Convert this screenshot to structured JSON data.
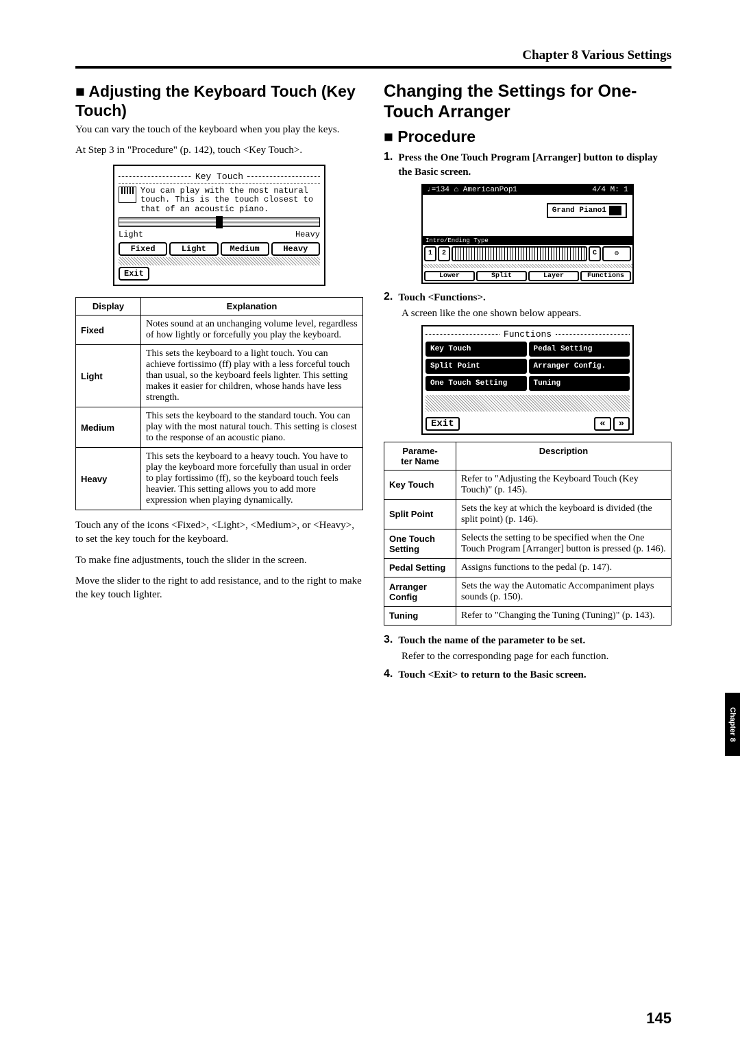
{
  "chapter_header": "Chapter 8 Various Settings",
  "left": {
    "heading": "■ Adjusting the Keyboard Touch (Key Touch)",
    "intro": "You can vary the touch of the keyboard when you play the keys.",
    "step_ref": "At Step 3 in \"Procedure\" (p. 142), touch <Key Touch>.",
    "lcd": {
      "title": "Key Touch",
      "desc": "You can play with the most natural touch. This is the touch closest to that of an acoustic piano.",
      "slider_left": "Light",
      "slider_right": "Heavy",
      "buttons": [
        "Fixed",
        "Light",
        "Medium",
        "Heavy"
      ],
      "exit": "Exit"
    },
    "table_headers": {
      "display": "Display",
      "explanation": "Explanation"
    },
    "table": [
      {
        "label": "Fixed",
        "text": "Notes sound at an unchanging volume level, regardless of how lightly or forcefully you play the keyboard."
      },
      {
        "label": "Light",
        "text": "This sets the keyboard to a light touch. You can achieve fortissimo (ff) play with a less forceful touch than usual, so the keyboard feels lighter. This setting makes it easier for children, whose hands have less strength."
      },
      {
        "label": "Medium",
        "text": "This sets the keyboard to the standard touch. You can play with the most natural touch. This setting is closest to the response of an acoustic piano."
      },
      {
        "label": "Heavy",
        "text": "This sets the keyboard to a heavy touch. You have to play the keyboard more forcefully than usual in order to play fortissimo (ff), so the keyboard touch feels heavier. This setting allows you to add more expression when playing dynamically."
      }
    ],
    "after1": "Touch any of the icons <Fixed>, <Light>, <Medium>, or <Heavy>, to set the key touch for the keyboard.",
    "after2": "To make fine adjustments, touch the slider in the screen.",
    "after3": "Move the slider to the right to add resistance, and to the right to make the key touch lighter."
  },
  "right": {
    "heading_big": "Changing the Settings for One-Touch Arranger",
    "heading_sub": "■ Procedure",
    "steps": {
      "s1": {
        "num": "1.",
        "text": "Press the One Touch Program [Arranger] button to display the Basic screen."
      },
      "s2": {
        "num": "2.",
        "text": "Touch <Functions>.",
        "sub": "A screen like the one shown below appears."
      },
      "s3": {
        "num": "3.",
        "text": "Touch the name of the parameter to be set.",
        "sub": "Refer to the corresponding page for each function."
      },
      "s4": {
        "num": "4.",
        "text": "Touch <Exit> to return to the Basic screen."
      }
    },
    "lcd_basic": {
      "top_left": "♩=134 ⌂ AmericanPop1",
      "top_right": "4/4 M:  1",
      "tone": "Grand Piano1",
      "strip": "Intro/Ending Type",
      "row1": [
        "1",
        "2"
      ],
      "row1_suffix": "C",
      "row2": [
        "Lower",
        "Split",
        "Layer",
        "Functions"
      ]
    },
    "lcd_functions": {
      "title": "Functions",
      "cells": [
        "Key Touch",
        "Pedal Setting",
        "Split Point",
        "Arranger Config.",
        "One Touch Setting",
        "Tuning"
      ],
      "exit": "Exit",
      "arrows": [
        "«",
        "»"
      ]
    },
    "table_headers": {
      "param": "Parame-\nter Name",
      "desc": "Description"
    },
    "table": [
      {
        "label": "Key Touch",
        "text": "Refer to \"Adjusting the Keyboard Touch (Key Touch)\" (p. 145)."
      },
      {
        "label": "Split Point",
        "text": "Sets the key at which the keyboard is divided (the split point) (p. 146)."
      },
      {
        "label": "One Touch Setting",
        "text": "Selects the setting to be specified when the One Touch Program [Arranger] button is pressed (p. 146)."
      },
      {
        "label": "Pedal Setting",
        "text": "Assigns functions to the pedal (p. 147)."
      },
      {
        "label": "Arranger Config",
        "text": "Sets the way the Automatic Accompaniment plays sounds (p. 150)."
      },
      {
        "label": "Tuning",
        "text": "Refer to \"Changing the Tuning (Tuning)\" (p. 143)."
      }
    ]
  },
  "side_tab": "Chapter 8",
  "page_number": "145"
}
